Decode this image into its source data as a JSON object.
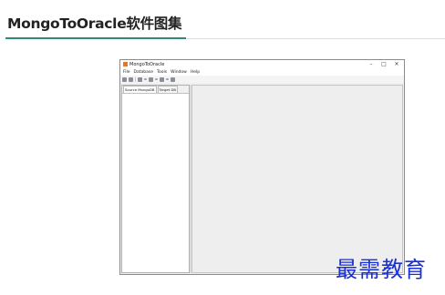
{
  "heading": {
    "title": "MongoToOracle软件图集"
  },
  "app_window": {
    "title": "MongoToOracle",
    "controls": {
      "minimize": "–",
      "maximize": "□",
      "close": "✕"
    },
    "menu": [
      "File",
      "Database",
      "Tools",
      "Window",
      "Help"
    ],
    "toolbar_icons": [
      "connect-icon",
      "edit-icon",
      "grid-icon",
      "dropdown-icon",
      "list-icon",
      "dropdown-icon",
      "table-icon",
      "dropdown-icon",
      "export-icon"
    ],
    "tabs": [
      {
        "label": "Source MongoDB",
        "active": true
      },
      {
        "label": "Target DB",
        "active": false
      }
    ]
  },
  "watermark": {
    "text": "最需教育"
  },
  "colors": {
    "accent": "#2e8b7a",
    "watermark": "#1a2fd6",
    "app_icon": "#e87722"
  }
}
